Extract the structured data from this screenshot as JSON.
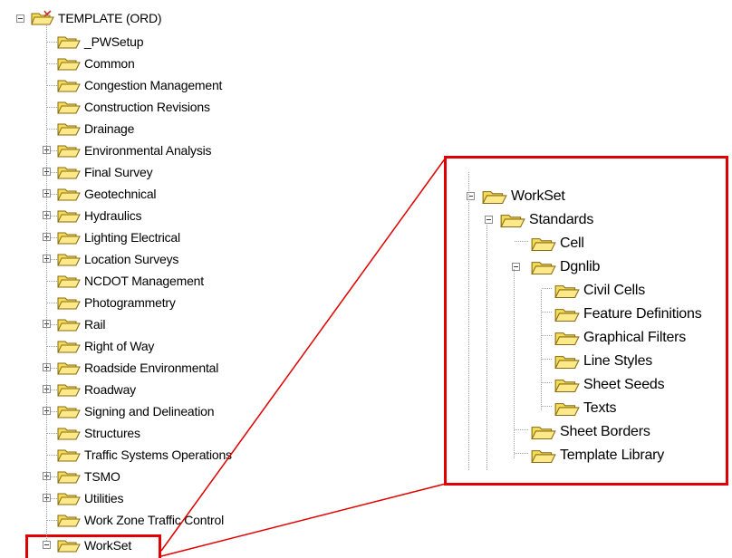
{
  "left_tree": {
    "root_label": "TEMPLATE (ORD)",
    "items": [
      {
        "label": "_PWSetup",
        "expandable": false
      },
      {
        "label": "Common",
        "expandable": false
      },
      {
        "label": "Congestion Management",
        "expandable": false
      },
      {
        "label": "Construction Revisions",
        "expandable": false
      },
      {
        "label": "Drainage",
        "expandable": false
      },
      {
        "label": "Environmental Analysis",
        "expandable": true
      },
      {
        "label": "Final Survey",
        "expandable": true
      },
      {
        "label": "Geotechnical",
        "expandable": true
      },
      {
        "label": "Hydraulics",
        "expandable": true
      },
      {
        "label": "Lighting Electrical",
        "expandable": true
      },
      {
        "label": "Location Surveys",
        "expandable": true
      },
      {
        "label": "NCDOT Management",
        "expandable": false
      },
      {
        "label": "Photogrammetry",
        "expandable": false
      },
      {
        "label": "Rail",
        "expandable": true
      },
      {
        "label": "Right of Way",
        "expandable": false
      },
      {
        "label": "Roadside Environmental",
        "expandable": true
      },
      {
        "label": "Roadway",
        "expandable": true
      },
      {
        "label": "Signing and Delineation",
        "expandable": true
      },
      {
        "label": "Structures",
        "expandable": false
      },
      {
        "label": "Traffic Systems Operations",
        "expandable": false
      },
      {
        "label": "TSMO",
        "expandable": true
      },
      {
        "label": "Utilities",
        "expandable": true
      },
      {
        "label": "Work Zone Traffic Control",
        "expandable": false
      },
      {
        "label": "WorkSet",
        "expandable": true
      }
    ]
  },
  "zoom_tree": {
    "workset": "WorkSet",
    "standards": "Standards",
    "cell": "Cell",
    "dgnlib": "Dgnlib",
    "dgnlib_children": [
      "Civil Cells",
      "Feature Definitions",
      "Graphical Filters",
      "Line Styles",
      "Sheet Seeds",
      "Texts"
    ],
    "sheet_borders": "Sheet Borders",
    "template_library": "Template Library"
  },
  "colors": {
    "highlight_red": "#e00000",
    "folder_yellow": "#f3dc57",
    "tree_line": "#a0a0a0"
  }
}
